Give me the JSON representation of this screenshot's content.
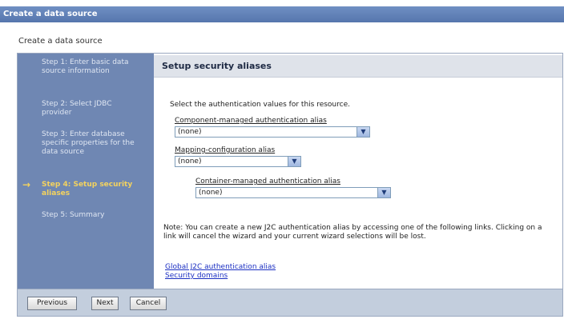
{
  "window_title": "Create a data source",
  "subtitle": "Create a data source",
  "steps": [
    {
      "label": "Step 1: Enter basic data source information",
      "active": false
    },
    {
      "label": "Step 2: Select JDBC provider",
      "active": false
    },
    {
      "label": "Step 3: Enter database specific properties for the data source",
      "active": false
    },
    {
      "label": "Step 4: Setup security aliases",
      "active": true
    },
    {
      "label": "Step 5: Summary",
      "active": false
    }
  ],
  "current_step_arrow": "→",
  "panel": {
    "title": "Setup security aliases",
    "instruction": "Select the authentication values for this resource.",
    "component_alias": {
      "label": "Component-managed authentication alias",
      "value": "(none)"
    },
    "mapping_alias": {
      "label": "Mapping-configuration alias",
      "value": "(none)"
    },
    "container_alias": {
      "label": "Container-managed authentication alias",
      "value": "(none)"
    },
    "note": "Note: You can create a new J2C authentication alias by accessing one of the following links. Clicking on a link will cancel the wizard and your current wizard selections will be lost.",
    "links": [
      "Global J2C authentication alias",
      "Security domains"
    ]
  },
  "buttons": {
    "previous": "Previous",
    "next": "Next",
    "cancel": "Cancel"
  },
  "icons": {
    "dropdown": "chevron-down-icon"
  },
  "colors": {
    "sidebar": "#6f87b3",
    "active_step": "#f4d35e",
    "header": "#5676ad",
    "link": "#1b2fc2"
  }
}
